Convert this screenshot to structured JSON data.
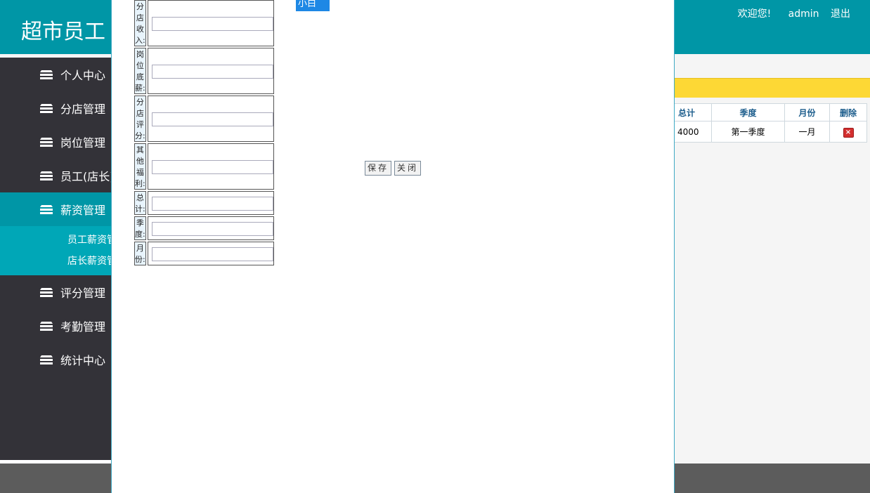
{
  "header": {
    "title": "超市员工",
    "welcome": "欢迎您!",
    "user": "admin",
    "logout": "退出"
  },
  "sidebar": {
    "items": [
      {
        "label": "个人中心",
        "icon": "menu-stack-icon"
      },
      {
        "label": "分店管理",
        "icon": "menu-stack-icon"
      },
      {
        "label": "岗位管理",
        "icon": "menu-stack-icon"
      },
      {
        "label": "员工(店长)",
        "icon": "menu-stack-icon"
      },
      {
        "label": "薪资管理",
        "icon": "menu-stack-icon"
      },
      {
        "label": "评分管理",
        "icon": "menu-stack-icon"
      },
      {
        "label": "考勤管理",
        "icon": "menu-stack-icon"
      },
      {
        "label": "统计中心",
        "icon": "menu-stack-icon"
      }
    ],
    "sub_items": [
      "员工薪资管理",
      "店长薪资管理"
    ]
  },
  "bg_table": {
    "headers": [
      "总计",
      "季度",
      "月份",
      "删除"
    ],
    "row": [
      "4000",
      "第一季度",
      "一月"
    ]
  },
  "form": {
    "rows": [
      {
        "label": "分店收入:",
        "value": ""
      },
      {
        "label": "岗位底薪:",
        "value": ""
      },
      {
        "label": "分店评分:",
        "value": ""
      },
      {
        "label": "其他福利:",
        "value": ""
      },
      {
        "label": "总计:",
        "value": ""
      },
      {
        "label": "季度:",
        "value": ""
      },
      {
        "label": "月份:",
        "value": ""
      }
    ],
    "dropdown_text": "小白",
    "save": "保存",
    "close": "关闭"
  },
  "colors": {
    "header": "#0096a6",
    "sidebar": "#333238",
    "active": "#0096a6",
    "submenu": "#00a7b7",
    "yellow": "#fdd835"
  }
}
